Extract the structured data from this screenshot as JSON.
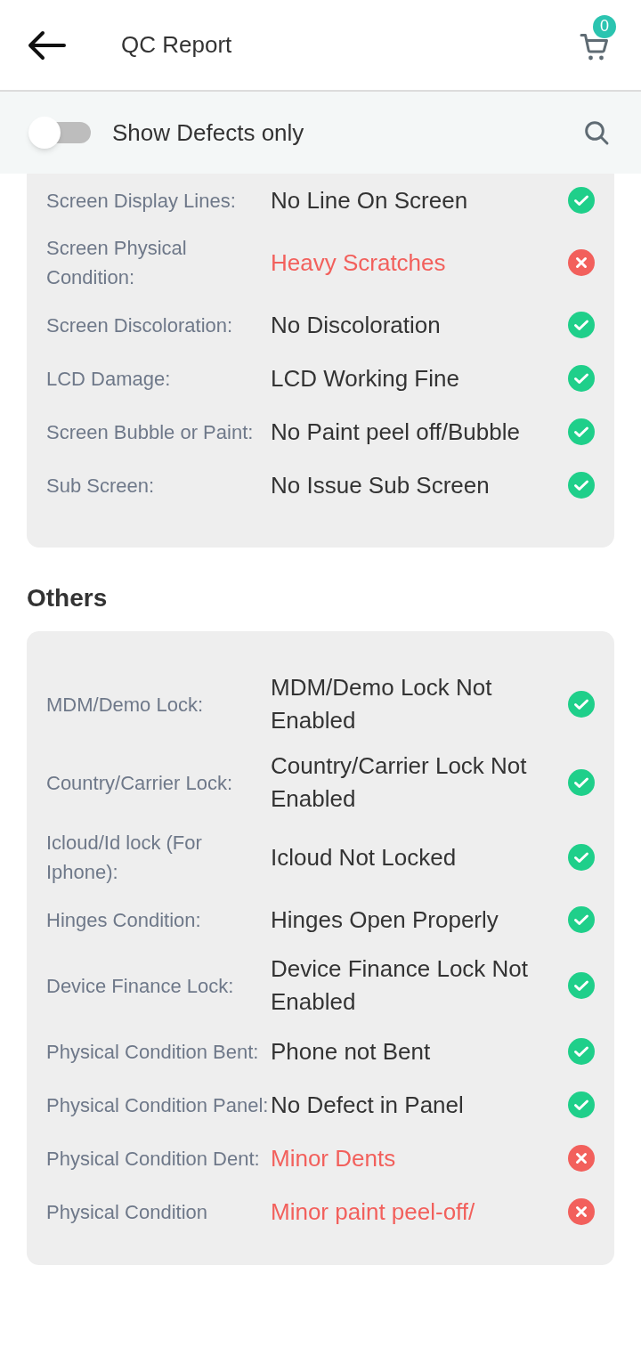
{
  "header": {
    "title": "QC Report",
    "cart_count": "0"
  },
  "filter": {
    "label": "Show Defects only",
    "on": false
  },
  "sections": [
    {
      "rows": [
        {
          "label": "Screen Display Lines:",
          "value": "No Line On Screen",
          "ok": true
        },
        {
          "label": "Screen Physical Condition:",
          "value": "Heavy Scratches",
          "ok": false
        },
        {
          "label": "Screen Discoloration:",
          "value": "No Discoloration",
          "ok": true
        },
        {
          "label": "LCD Damage:",
          "value": "LCD Working Fine",
          "ok": true
        },
        {
          "label": "Screen Bubble or Paint:",
          "value": "No Paint peel off/Bubble",
          "ok": true
        },
        {
          "label": "Sub Screen:",
          "value": "No Issue Sub Screen",
          "ok": true
        }
      ]
    },
    {
      "title": "Others",
      "rows": [
        {
          "label": "MDM/Demo Lock:",
          "value": "MDM/Demo Lock Not Enabled",
          "ok": true
        },
        {
          "label": "Country/Carrier Lock:",
          "value": "Country/Carrier Lock Not Enabled",
          "ok": true
        },
        {
          "label": "Icloud/Id lock (For Iphone):",
          "value": "Icloud Not Locked",
          "ok": true
        },
        {
          "label": "Hinges Condition:",
          "value": "Hinges Open Properly",
          "ok": true
        },
        {
          "label": "Device Finance Lock:",
          "value": "Device Finance Lock Not Enabled",
          "ok": true
        },
        {
          "label": "Physical Condition Bent:",
          "value": "Phone not Bent",
          "ok": true
        },
        {
          "label": "Physical Condition Panel:",
          "value": "No Defect in Panel",
          "ok": true
        },
        {
          "label": "Physical Condition Dent:",
          "value": "Minor Dents",
          "ok": false
        },
        {
          "label": "Physical Condition",
          "value": "Minor paint peel-off/",
          "ok": false
        }
      ]
    }
  ]
}
